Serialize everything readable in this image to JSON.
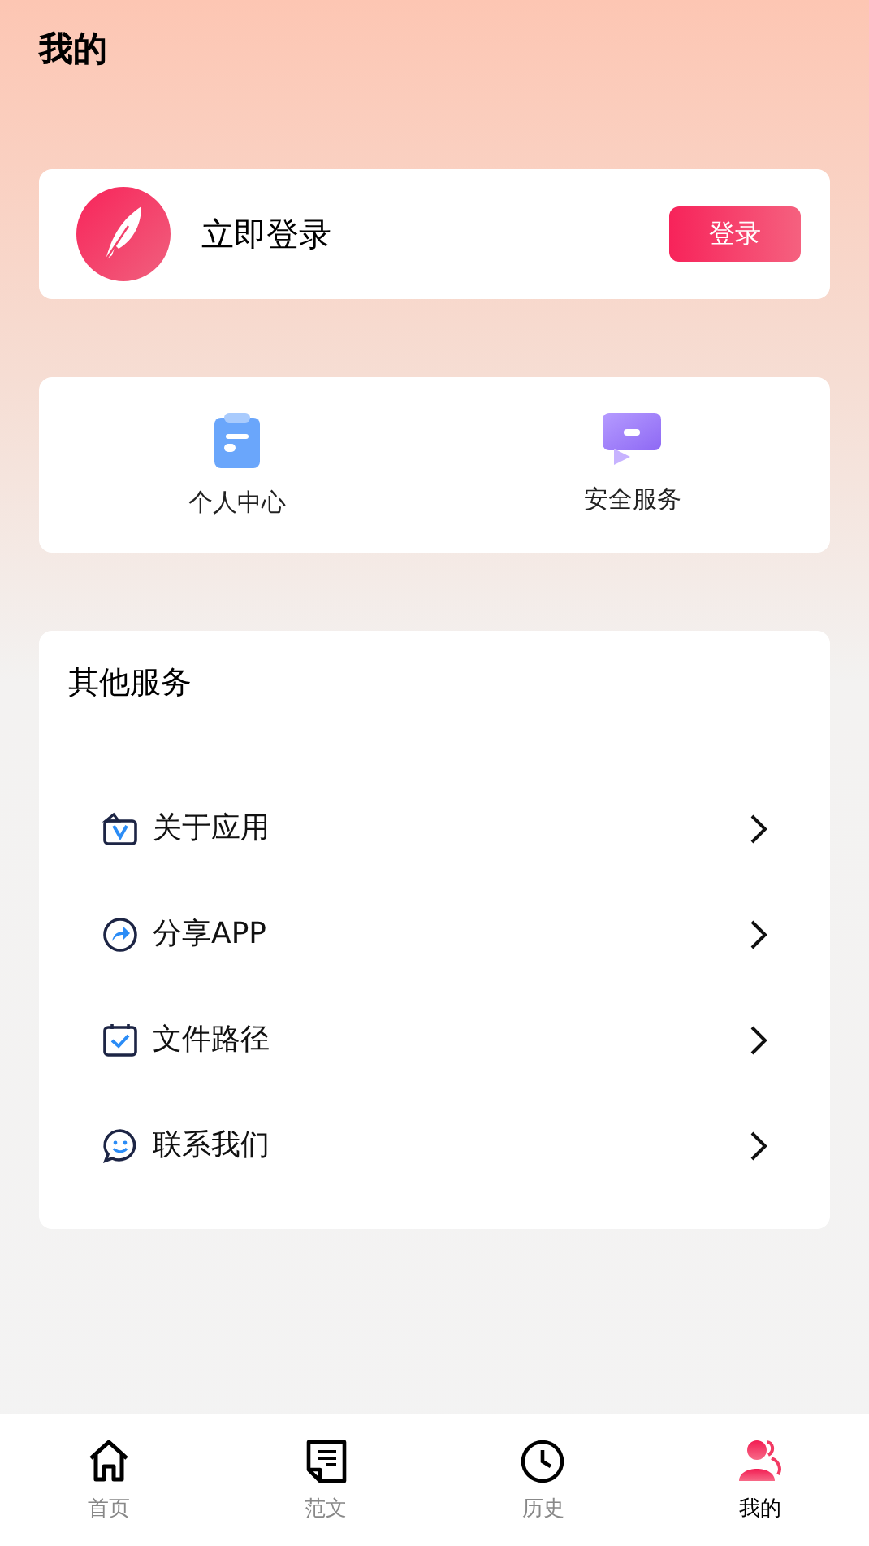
{
  "header": {
    "title": "我的"
  },
  "login_card": {
    "prompt": "立即登录",
    "button": "登录"
  },
  "quick_actions": [
    {
      "label": "个人中心"
    },
    {
      "label": "安全服务"
    }
  ],
  "other_services": {
    "title": "其他服务",
    "items": [
      {
        "label": "关于应用"
      },
      {
        "label": "分享APP"
      },
      {
        "label": "文件路径"
      },
      {
        "label": "联系我们"
      }
    ]
  },
  "tab_bar": [
    {
      "label": "首页",
      "selected": false
    },
    {
      "label": "范文",
      "selected": false
    },
    {
      "label": "历史",
      "selected": false
    },
    {
      "label": "我的",
      "selected": true
    }
  ]
}
